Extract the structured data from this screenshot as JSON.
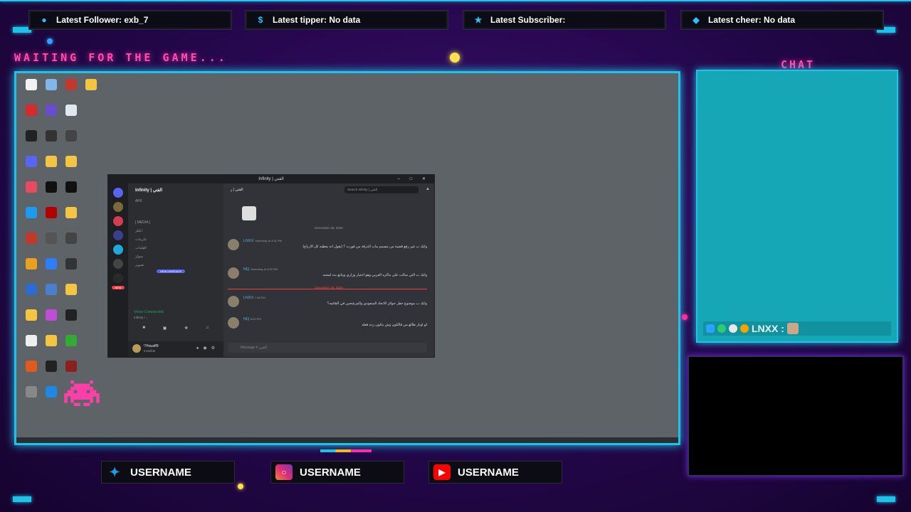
{
  "alerts": [
    {
      "label": "Latest Follower: exb_7",
      "icon": "user-icon"
    },
    {
      "label": "Latest tipper: No data",
      "icon": "dollar-icon"
    },
    {
      "label": "Latest Subscriber:",
      "icon": "star-icon"
    },
    {
      "label": "Latest cheer: No data",
      "icon": "diamond-icon"
    }
  ],
  "status_text": "WAITING FOR THE GAME...",
  "chat": {
    "title": "CHAT",
    "username": "LNXX :"
  },
  "discord": {
    "window_title": "Infinity | القتي",
    "server_name": "Infinity | القتي",
    "channel_header": "القتي | ر",
    "search_placeholder": "Search Infinity | القتي",
    "voice_status": "Voice Connected",
    "voice_channel": "Infinity / ...",
    "user": "!!Yousf®",
    "user_status": "Invisible",
    "message_placeholder": "Message #  القتي",
    "date_1": "December 28, 2025",
    "date_2": "December 29, 2025",
    "new_badge": "NEW",
    "new_unreads": "NEW UNREADS",
    "channels": [
      "AFK",
      "[ MEDIA ]",
      "انكلز",
      "تكرينات",
      "القلدات",
      "سولز",
      "تصوير"
    ],
    "messages": [
      {
        "name": "LNXX",
        "time": "Yesterday at 3:41 PM",
        "text": "وابك ب غير رفع قضية من مصمم ماب الدرقة من فورت ؟ (بقول انه يعطيه كل الارباح)"
      },
      {
        "name": "NQ",
        "time": "Yesterday at 4:03 PM",
        "text": "وابك ب التي سالب على ماكره العربي وهو اختيار وزاري ويتابع بث لمحبه"
      },
      {
        "name": "LNXX",
        "time": "7:48 PM",
        "text": "وابك ب موضوع حفل جوائز الاتحاد السعودي والمرشحين في القائمه؟"
      },
      {
        "name": "NQ",
        "time": "8:02 PM",
        "text": "لو اوبار طالع من فالكون وش بتكون رده فعله"
      }
    ]
  },
  "socials": [
    {
      "label": "USERNAME",
      "icon": "twitter-icon",
      "color": "#1d9bf0"
    },
    {
      "label": "USERNAME",
      "icon": "instagram-icon",
      "color": "#c13584"
    },
    {
      "label": "USERNAME",
      "icon": "youtube-icon",
      "color": "#ff0000"
    }
  ],
  "colors": {
    "neon_cyan": "#1fc3e8",
    "neon_pink": "#ff4fae",
    "background": "#23074a"
  }
}
